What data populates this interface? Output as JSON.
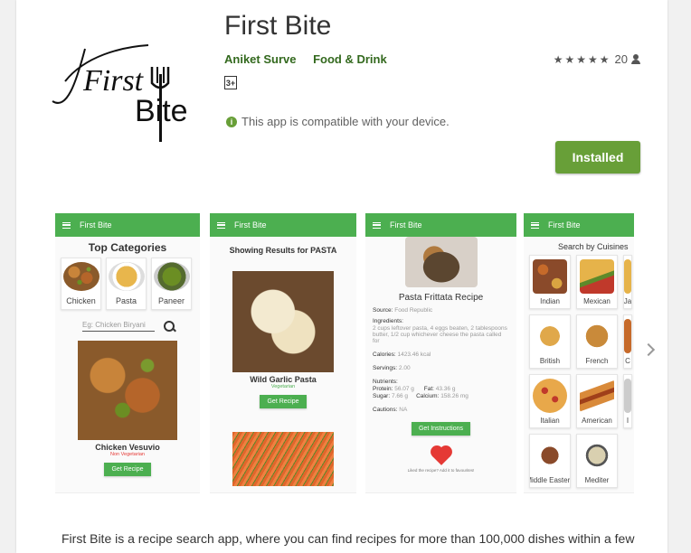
{
  "app": {
    "title": "First Bite",
    "developer": "Aniket Surve",
    "category": "Food & Drink",
    "rating_stars": "★★★★★",
    "rating_count": "20",
    "age_rating": "3+",
    "compatibility": "This app is compatible with your device.",
    "install_label": "Installed",
    "description": "First Bite is a recipe search app, where you can find recipes for more than 100,000 dishes within a few"
  },
  "logo": {
    "line1": "First",
    "line2": "Bite"
  },
  "colors": {
    "accent": "#689f38",
    "appbar": "#4caf50",
    "dev_link": "#33691e"
  },
  "screenshots": [
    {
      "appbar_title": "First Bite",
      "heading": "Top Categories",
      "categories": [
        "Chicken",
        "Pasta",
        "Paneer"
      ],
      "search_placeholder": "Eg: Chicken Biryani",
      "dish": "Chicken Vesuvio",
      "dish_tag": "Non Vegetarian",
      "button": "Get Recipe"
    },
    {
      "appbar_title": "First Bite",
      "heading": "Showing Results for PASTA",
      "dish": "Wild Garlic Pasta",
      "dish_tag": "Vegetarian",
      "button": "Get Recipe"
    },
    {
      "appbar_title": "First Bite",
      "recipe_title": "Pasta Frittata Recipe",
      "source_label": "Source:",
      "source_value": "Food Republic",
      "ingredients_label": "Ingredients:",
      "ingredients_value": "2 cups leftover pasta, 4 eggs beaten, 2 tablespoons butter, 1/2 cup whichever cheese the pasta called for",
      "calories_label": "Calories:",
      "calories_value": "1423.46 kcal",
      "servings_label": "Servings:",
      "servings_value": "2.00",
      "nutrients_label": "Nutrients:",
      "protein_label": "Protein:",
      "protein_value": "56.07 g",
      "fat_label": "Fat:",
      "fat_value": "43.36 g",
      "sugar_label": "Sugar:",
      "sugar_value": "7.66 g",
      "calcium_label": "Calcium:",
      "calcium_value": "158.26 mg",
      "cautions_label": "Cautions:",
      "cautions_value": "NA",
      "button": "Get Instructions",
      "footer": "Liked the recipe? Add it to favourites!"
    },
    {
      "appbar_title": "First Bite",
      "heading": "Search by Cuisines",
      "cuisines": [
        "Indian",
        "Mexican",
        "Ja",
        "British",
        "French",
        "C",
        "Italian",
        "American",
        "I",
        "Middle Eastern",
        "Mediter"
      ]
    }
  ]
}
